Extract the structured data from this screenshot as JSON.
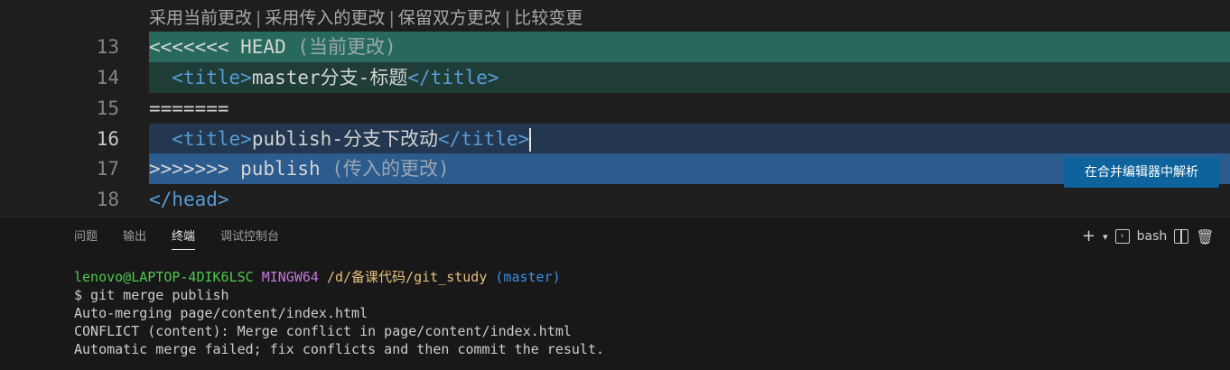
{
  "codelens": {
    "accept_current": "采用当前更改",
    "accept_incoming": "采用传入的更改",
    "accept_both": "保留双方更改",
    "compare": "比较变更",
    "separator": "|"
  },
  "editor": {
    "lines": [
      {
        "number": "13",
        "marker": "<<<<<<< HEAD",
        "hint": "(当前更改)"
      },
      {
        "number": "14",
        "open_tag": "title",
        "text": "master分支-标题",
        "close_tag": "title"
      },
      {
        "number": "15",
        "marker": "======="
      },
      {
        "number": "16",
        "open_tag": "title",
        "text": "publish-分支下改动",
        "close_tag": "title"
      },
      {
        "number": "17",
        "marker": ">>>>>>> publish",
        "hint": "(传入的更改)"
      },
      {
        "number": "18",
        "close_tag": "head"
      }
    ],
    "resolve_button": "在合并编辑器中解析"
  },
  "panel": {
    "tabs": [
      "问题",
      "输出",
      "终端",
      "调试控制台"
    ],
    "active_tab": "终端",
    "shell_label": "bash"
  },
  "terminal": {
    "prompt_user": "lenovo@LAPTOP-4DIK6LSC",
    "prompt_shell": "MINGW64",
    "prompt_path": "/d/备课代码/git_study",
    "prompt_branch": "(master)",
    "command": "$ git merge publish",
    "output": [
      "Auto-merging page/content/index.html",
      "CONFLICT (content): Merge conflict in page/content/index.html",
      "Automatic merge failed; fix conflicts and then commit the result."
    ]
  },
  "colors": {
    "current_header": "#276a5b",
    "current_body": "#1f3c37",
    "incoming_body": "#233750",
    "incoming_header": "#2c5b8e",
    "button": "#0e639c"
  }
}
